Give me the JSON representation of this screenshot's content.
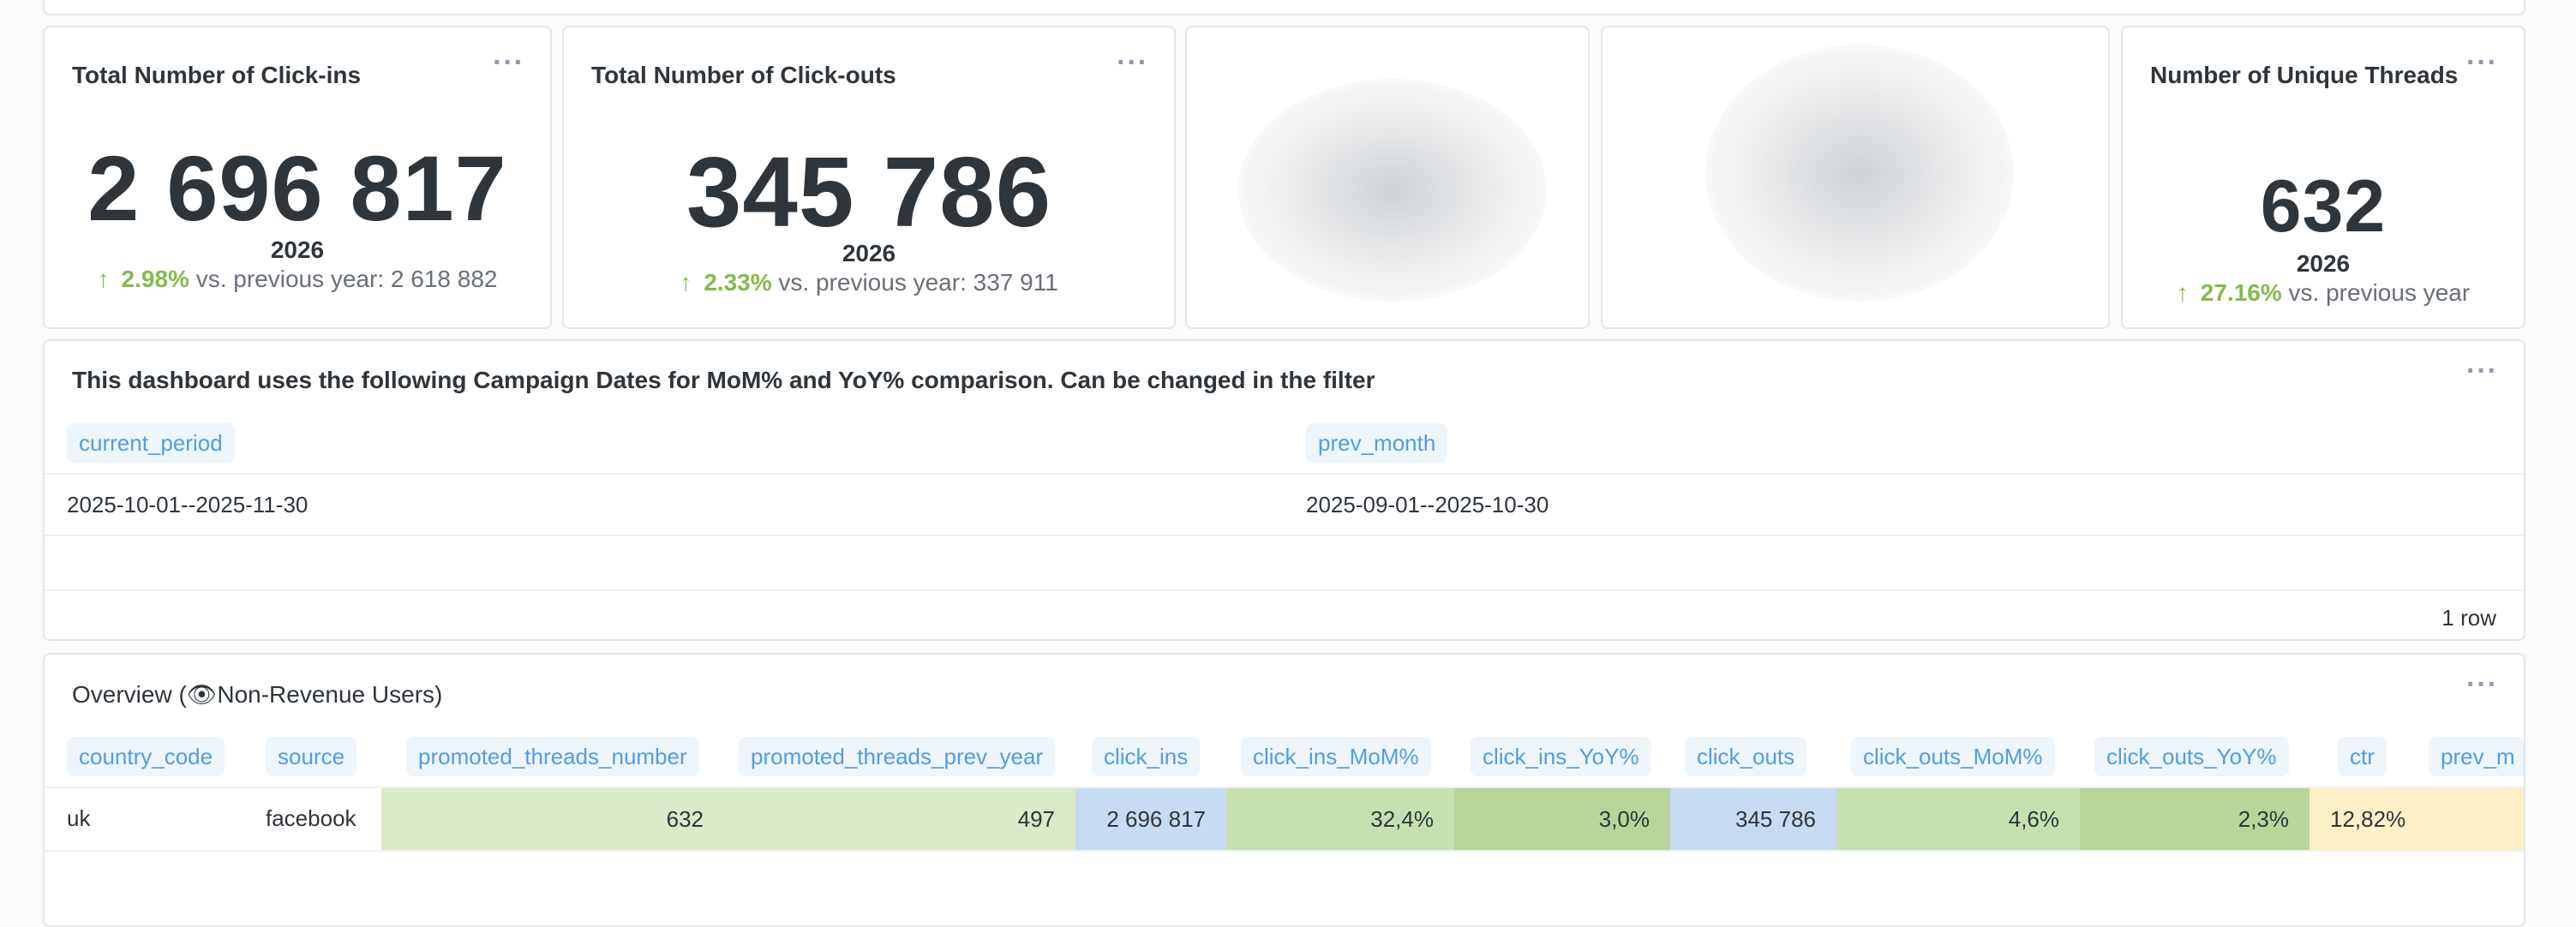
{
  "kpis": [
    {
      "title": "Total Number of Click-ins",
      "value": "2 696 817",
      "period": "2026",
      "change_pct": "2.98%",
      "compare_label": "vs. previous year: 2 618 882"
    },
    {
      "title": "Total Number of Click-outs",
      "value": "345 786",
      "period": "2026",
      "change_pct": "2.33%",
      "compare_label": "vs. previous year: 337 911"
    },
    {
      "title": "Number of Unique Threads",
      "value": "632",
      "period": "2026",
      "change_pct": "27.16%",
      "compare_label": "vs. previous year"
    }
  ],
  "icons": {
    "menu": "more-horizontal-icon",
    "up": "arrow-up-icon",
    "eye": "eye-icon"
  },
  "colors": {
    "accent": "#509ee3",
    "positive": "#84bb4c",
    "green_light": "#dbeac7",
    "green_mid": "#c7e0b0",
    "green_dark": "#b8d59a",
    "blue_cell": "#c6dcf4",
    "yellow_cell": "#fdefc6"
  },
  "campaign": {
    "title": "This dashboard uses the following Campaign Dates for MoM% and YoY% comparison. Can be changed in the filter",
    "columns": [
      "current_period",
      "prev_month"
    ],
    "row": [
      "2025-10-01--2025-11-30",
      "2025-09-01--2025-10-30"
    ],
    "row_count": "1 row"
  },
  "overview": {
    "title_prefix": "Overview (",
    "title_suffix": "Non-Revenue Users)",
    "eye_glyph": "👁",
    "columns": [
      "country_code",
      "source",
      "promoted_threads_number",
      "promoted_threads_prev_year",
      "click_ins",
      "click_ins_MoM%",
      "click_ins_YoY%",
      "click_outs",
      "click_outs_MoM%",
      "click_outs_YoY%",
      "ctr",
      "prev_m"
    ],
    "row": [
      "uk",
      "facebook",
      "632",
      "497",
      "2 696 817",
      "32,4%",
      "3,0%",
      "345 786",
      "4,6%",
      "2,3%",
      "12,82%",
      ""
    ]
  }
}
